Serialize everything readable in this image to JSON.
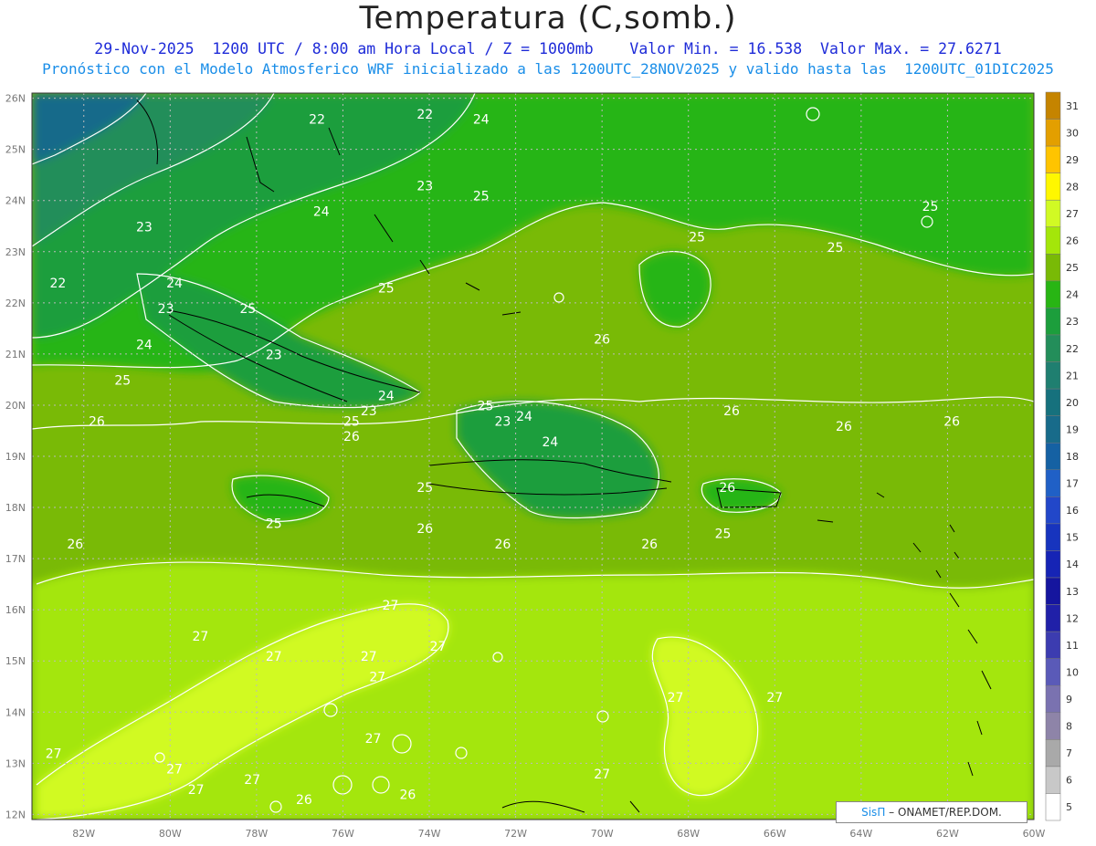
{
  "header": {
    "title": "Temperatura (C,somb.)",
    "line1": "29-Nov-2025  1200 UTC / 8:00 am Hora Local / Z = 1000mb    Valor Min. = 16.538  Valor Max. = 27.6271",
    "line2": "Pronóstico con el Modelo Atmosferico WRF inicializado a las 1200UTC_28NOV2025 y valido hasta las  1200UTC_01DIC2025"
  },
  "map": {
    "lon_range": [
      -83.2,
      -60
    ],
    "lat_range": [
      11.9,
      26.1
    ],
    "lat_ticks": [
      "26N",
      "25N",
      "24N",
      "23N",
      "22N",
      "21N",
      "20N",
      "19N",
      "18N",
      "17N",
      "16N",
      "15N",
      "14N",
      "13N",
      "12N"
    ],
    "lon_ticks": [
      "82W",
      "80W",
      "78W",
      "76W",
      "74W",
      "72W",
      "70W",
      "68W",
      "66W",
      "64W",
      "62W",
      "60W"
    ],
    "grid": true,
    "contour_labels": [
      {
        "text": "22",
        "lon": -76.6,
        "lat": 25.5
      },
      {
        "text": "22",
        "lon": -74.1,
        "lat": 25.6
      },
      {
        "text": "24",
        "lon": -72.8,
        "lat": 25.5
      },
      {
        "text": "23",
        "lon": -74.1,
        "lat": 24.2
      },
      {
        "text": "24",
        "lon": -76.5,
        "lat": 23.7
      },
      {
        "text": "25",
        "lon": -72.8,
        "lat": 24.0
      },
      {
        "text": "23",
        "lon": -80.6,
        "lat": 23.4
      },
      {
        "text": "25",
        "lon": -67.8,
        "lat": 23.2
      },
      {
        "text": "25",
        "lon": -64.6,
        "lat": 23.0
      },
      {
        "text": "25",
        "lon": -62.4,
        "lat": 23.8
      },
      {
        "text": "22",
        "lon": -82.6,
        "lat": 22.3
      },
      {
        "text": "24",
        "lon": -79.9,
        "lat": 22.3
      },
      {
        "text": "23",
        "lon": -80.1,
        "lat": 21.8
      },
      {
        "text": "25",
        "lon": -78.2,
        "lat": 21.8
      },
      {
        "text": "25",
        "lon": -75.0,
        "lat": 22.2
      },
      {
        "text": "24",
        "lon": -80.6,
        "lat": 21.1
      },
      {
        "text": "23",
        "lon": -77.6,
        "lat": 20.9
      },
      {
        "text": "26",
        "lon": -70.0,
        "lat": 21.2
      },
      {
        "text": "25",
        "lon": -81.1,
        "lat": 20.4
      },
      {
        "text": "24",
        "lon": -75.0,
        "lat": 20.1
      },
      {
        "text": "23",
        "lon": -75.4,
        "lat": 19.8
      },
      {
        "text": "25",
        "lon": -72.7,
        "lat": 19.9
      },
      {
        "text": "23",
        "lon": -72.3,
        "lat": 19.6
      },
      {
        "text": "24",
        "lon": -71.8,
        "lat": 19.7
      },
      {
        "text": "26",
        "lon": -67.0,
        "lat": 19.8
      },
      {
        "text": "26",
        "lon": -81.7,
        "lat": 19.6
      },
      {
        "text": "25",
        "lon": -75.8,
        "lat": 19.6
      },
      {
        "text": "26",
        "lon": -75.8,
        "lat": 19.3
      },
      {
        "text": "24",
        "lon": -71.2,
        "lat": 19.2
      },
      {
        "text": "26",
        "lon": -64.4,
        "lat": 19.5
      },
      {
        "text": "26",
        "lon": -61.9,
        "lat": 19.6
      },
      {
        "text": "26",
        "lon": -67.1,
        "lat": 18.3
      },
      {
        "text": "25",
        "lon": -74.1,
        "lat": 18.3
      },
      {
        "text": "25",
        "lon": -67.2,
        "lat": 17.4
      },
      {
        "text": "25",
        "lon": -77.6,
        "lat": 17.6
      },
      {
        "text": "26",
        "lon": -82.2,
        "lat": 17.2
      },
      {
        "text": "26",
        "lon": -74.1,
        "lat": 17.5
      },
      {
        "text": "26",
        "lon": -72.3,
        "lat": 17.2
      },
      {
        "text": "26",
        "lon": -68.9,
        "lat": 17.2
      },
      {
        "text": "27",
        "lon": -74.9,
        "lat": 16.0
      },
      {
        "text": "27",
        "lon": -79.3,
        "lat": 15.4
      },
      {
        "text": "27",
        "lon": -73.8,
        "lat": 15.2
      },
      {
        "text": "27",
        "lon": -77.6,
        "lat": 15.0
      },
      {
        "text": "27",
        "lon": -75.4,
        "lat": 15.0
      },
      {
        "text": "27",
        "lon": -75.2,
        "lat": 14.6
      },
      {
        "text": "27",
        "lon": -68.3,
        "lat": 14.2
      },
      {
        "text": "27",
        "lon": -66.0,
        "lat": 14.2
      },
      {
        "text": "27",
        "lon": -75.3,
        "lat": 13.4
      },
      {
        "text": "27",
        "lon": -82.7,
        "lat": 13.1
      },
      {
        "text": "27",
        "lon": -79.9,
        "lat": 12.8
      },
      {
        "text": "27",
        "lon": -78.1,
        "lat": 12.6
      },
      {
        "text": "27",
        "lon": -79.4,
        "lat": 12.4
      },
      {
        "text": "26",
        "lon": -74.5,
        "lat": 12.3
      },
      {
        "text": "26",
        "lon": -76.9,
        "lat": 12.2
      },
      {
        "text": "27",
        "lon": -70.0,
        "lat": 12.7
      }
    ]
  },
  "colorbar": {
    "levels": [
      "31",
      "30",
      "29",
      "28",
      "27",
      "26",
      "25",
      "24",
      "23",
      "22",
      "21",
      "20",
      "19",
      "18",
      "17",
      "16",
      "15",
      "14",
      "13",
      "12",
      "11",
      "10",
      "9",
      "8",
      "7",
      "6",
      "5"
    ],
    "colors": [
      "#c58400",
      "#e39f00",
      "#ffc400",
      "#fff700",
      "#d1fa24",
      "#a4e60a",
      "#79ba06",
      "#28b514",
      "#1c9e3c",
      "#238e5a",
      "#1f7f70",
      "#16717d",
      "#186b8a",
      "#1561a3",
      "#2060c6",
      "#2247c9",
      "#1734be",
      "#1624b5",
      "#15159e",
      "#2020a8",
      "#3c3cb0",
      "#5a5ab8",
      "#7a72b0",
      "#8e84a8",
      "#a9a9a9",
      "#c8c8c8",
      "#ffffff"
    ]
  },
  "credit": {
    "brand": "SisΠ",
    "text": " – ONAMET/REP.DOM."
  }
}
